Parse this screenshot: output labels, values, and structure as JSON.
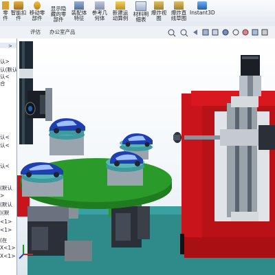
{
  "ribbon": {
    "buttons": [
      {
        "label_1": "零",
        "label_2": "件"
      },
      {
        "label_1": "智能扣",
        "label_2": "件"
      },
      {
        "label_1": "移动零",
        "label_2": "部件"
      },
      {
        "label_1": "显示隐",
        "label_2": "藏的零",
        "label_3": "部件"
      },
      {
        "label_1": "装配体",
        "label_2": "特征"
      },
      {
        "label_1": "参考几",
        "label_2": "何体"
      },
      {
        "label_1": "新建运",
        "label_2": "动算例"
      },
      {
        "label_1": "材料明",
        "label_2": "细表"
      },
      {
        "label_1": "爆炸视",
        "label_2": "图"
      },
      {
        "label_1": "爆炸直",
        "label_2": "线草图"
      },
      {
        "label_1": "Instant3D"
      }
    ]
  },
  "tabs": [
    "评估",
    "办公室产品"
  ],
  "tree_rows": [
    "认>",
    "认(默认",
    "认<",
    "合",
    "认<",
    "认<",
    "认<",
    "(默认",
    ">",
    "(默认",
    ")(默",
    "<1>",
    "<1>",
    "(在",
    "X<1>",
    "X<1>"
  ],
  "colors": {
    "frame_red": "#c8141a",
    "turntable_green": "#2a9a2a",
    "fixture_teal": "#3f9aa0",
    "car_blue": "#1f3fb0",
    "base_teal": "#2f8a8a"
  }
}
